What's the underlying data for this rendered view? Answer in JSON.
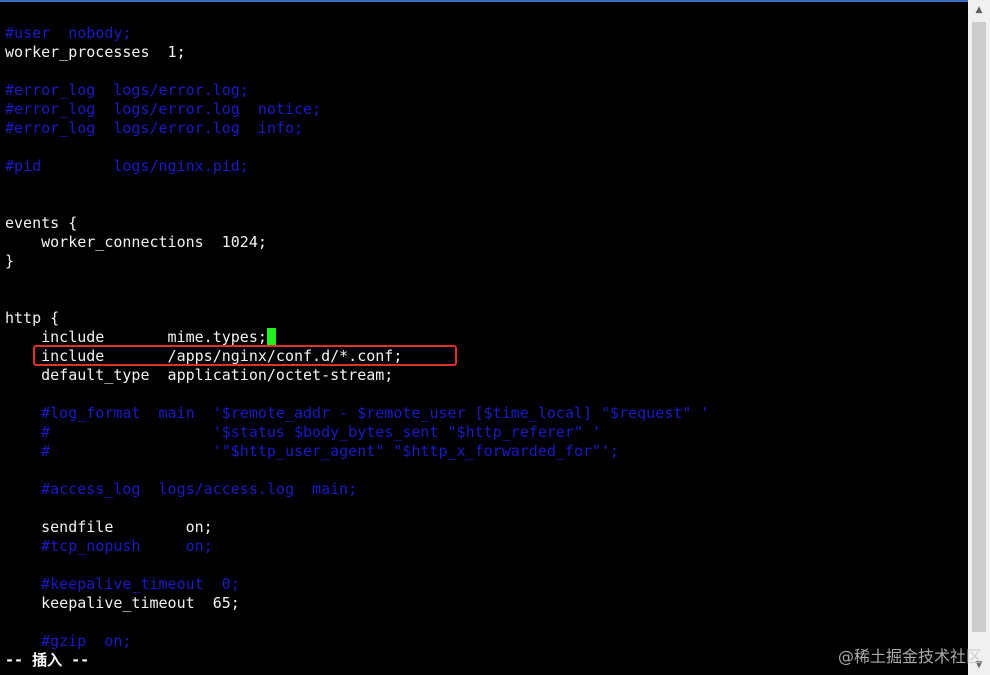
{
  "editor": {
    "lines": [
      {
        "text": "#user  nobody;",
        "comment": true
      },
      {
        "text": "worker_processes  1;",
        "comment": false
      },
      {
        "text": "",
        "comment": false
      },
      {
        "text": "#error_log  logs/error.log;",
        "comment": true
      },
      {
        "text": "#error_log  logs/error.log  notice;",
        "comment": true
      },
      {
        "text": "#error_log  logs/error.log  info;",
        "comment": true
      },
      {
        "text": "",
        "comment": false
      },
      {
        "text": "#pid        logs/nginx.pid;",
        "comment": true
      },
      {
        "text": "",
        "comment": false
      },
      {
        "text": "",
        "comment": false
      },
      {
        "text": "events {",
        "comment": false
      },
      {
        "text": "    worker_connections  1024;",
        "comment": false
      },
      {
        "text": "}",
        "comment": false
      },
      {
        "text": "",
        "comment": false
      },
      {
        "text": "",
        "comment": false
      },
      {
        "text": "http {",
        "comment": false
      },
      {
        "text": "    include       mime.types;",
        "comment": false
      },
      {
        "text": "    include       /apps/nginx/conf.d/*.conf;",
        "comment": false
      },
      {
        "text": "    default_type  application/octet-stream;",
        "comment": false
      },
      {
        "text": "",
        "comment": false
      },
      {
        "text": "    #log_format  main  '$remote_addr - $remote_user [$time_local] \"$request\" '",
        "comment": true
      },
      {
        "text": "    #                  '$status $body_bytes_sent \"$http_referer\" '",
        "comment": true
      },
      {
        "text": "    #                  '\"$http_user_agent\" \"$http_x_forwarded_for\"';",
        "comment": true
      },
      {
        "text": "",
        "comment": false
      },
      {
        "text": "    #access_log  logs/access.log  main;",
        "comment": true
      },
      {
        "text": "",
        "comment": false
      },
      {
        "text": "    sendfile        on;",
        "comment": false
      },
      {
        "text": "    #tcp_nopush     on;",
        "comment": true
      },
      {
        "text": "",
        "comment": false
      },
      {
        "text": "    #keepalive_timeout  0;",
        "comment": true
      },
      {
        "text": "    keepalive_timeout  65;",
        "comment": false
      },
      {
        "text": "",
        "comment": false
      },
      {
        "text": "    #gzip  on;",
        "comment": true
      }
    ],
    "cursor_line_index": 16,
    "highlighted_line_index": 17
  },
  "statusline": {
    "mode_text": "-- 插入 --"
  },
  "watermark": {
    "text": "@稀土掘金技术社区"
  },
  "colors": {
    "background": "#000000",
    "text": "#f2f2f2",
    "comment": "#1a1ac6",
    "cursor": "#22ee22",
    "highlight_border": "#e0302a"
  }
}
